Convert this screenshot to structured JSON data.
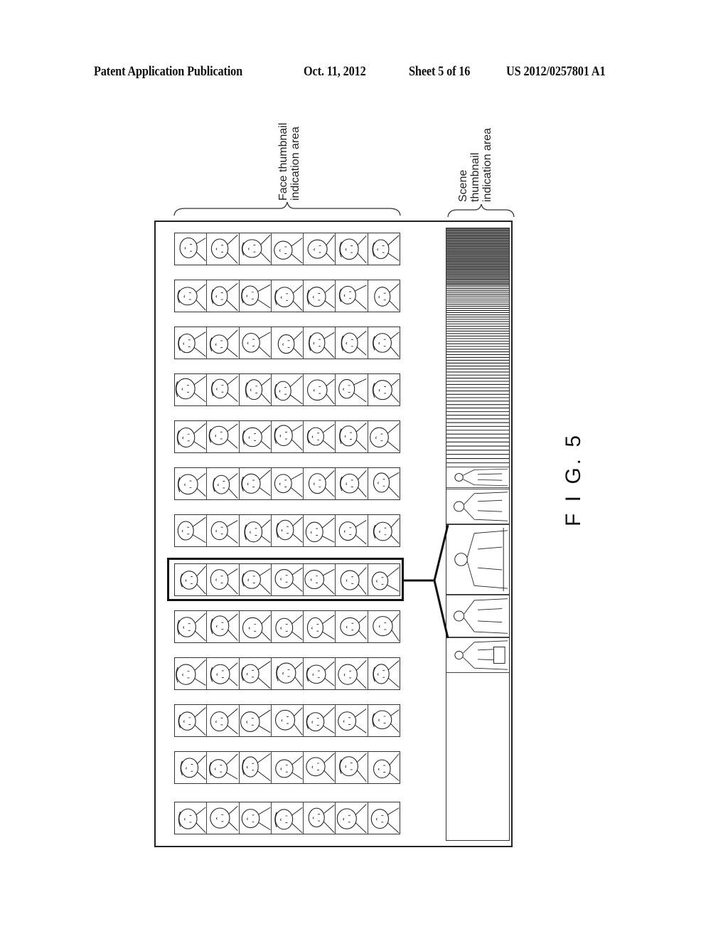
{
  "header": {
    "publication_type": "Patent Application Publication",
    "date": "Oct. 11, 2012",
    "sheet": "Sheet 5 of 16",
    "publication_number": "US 2012/0257801 A1"
  },
  "figure": {
    "label": "F I G. 5",
    "face_area_label": [
      "Face thumbnail",
      "indication area"
    ],
    "scene_area_label": [
      "Scene",
      "thumbnail",
      "indication area"
    ],
    "face_rows": 13,
    "faces_per_row": 7,
    "selected_row_index": 7,
    "scene_thumbnails": [
      {
        "name": "scene-person-small-1",
        "enlarged": false
      },
      {
        "name": "scene-person-2",
        "enlarged": false
      },
      {
        "name": "scene-person-selected",
        "enlarged": true
      },
      {
        "name": "scene-person-4",
        "enlarged": false
      },
      {
        "name": "scene-person-with-box",
        "enlarged": false
      }
    ]
  }
}
